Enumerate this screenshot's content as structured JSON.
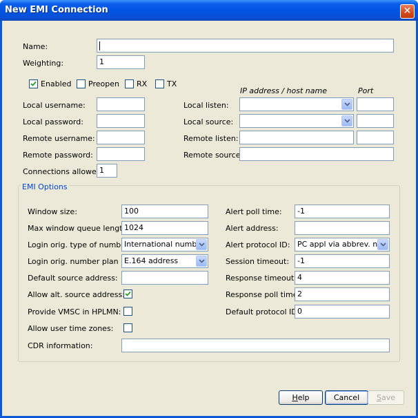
{
  "window": {
    "title": "New EMI Connection",
    "close_glyph": "✕"
  },
  "fields": {
    "name": {
      "label": "Name:",
      "value": ""
    },
    "weighting": {
      "label": "Weighting:",
      "value": "1"
    },
    "enabled": {
      "label": "Enabled",
      "checked": true
    },
    "preopen": {
      "label": "Preopen",
      "checked": false
    },
    "rx": {
      "label": "RX",
      "checked": false
    },
    "tx": {
      "label": "TX",
      "checked": false
    },
    "ip_header": "IP address / host name",
    "port_header": "Port",
    "local_username": {
      "label": "Local username:",
      "value": ""
    },
    "local_password": {
      "label": "Local password:",
      "value": ""
    },
    "remote_username": {
      "label": "Remote username:",
      "value": ""
    },
    "remote_password": {
      "label": "Remote password:",
      "value": ""
    },
    "connections_allowed": {
      "label": "Connections allowed:",
      "value": "1"
    },
    "local_listen": {
      "label": "Local listen:",
      "value": "",
      "port": ""
    },
    "local_source": {
      "label": "Local source:",
      "value": "",
      "port": ""
    },
    "remote_listen": {
      "label": "Remote listen:",
      "value": "",
      "port": ""
    },
    "remote_source": {
      "label": "Remote source:",
      "value": ""
    }
  },
  "emi_options": {
    "title": "EMI Options",
    "window_size": {
      "label": "Window size:",
      "value": "100"
    },
    "max_window_queue": {
      "label": "Max window queue length:",
      "value": "1024"
    },
    "login_type": {
      "label": "Login orig. type of number:",
      "value": "International number"
    },
    "login_plan": {
      "label": "Login orig. number plan ID:",
      "value": "E.164 address"
    },
    "default_source": {
      "label": "Default source address:",
      "value": ""
    },
    "allow_alt_source": {
      "label": "Allow alt. source address:",
      "checked": true
    },
    "provide_vmsc": {
      "label": "Provide VMSC in HPLMN:",
      "checked": false
    },
    "allow_user_tz": {
      "label": "Allow user time zones:",
      "checked": false
    },
    "cdr_info": {
      "label": "CDR information:",
      "value": ""
    },
    "alert_poll_time": {
      "label": "Alert poll time:",
      "value": "-1"
    },
    "alert_address": {
      "label": "Alert address:",
      "value": ""
    },
    "alert_protocol": {
      "label": "Alert protocol ID:",
      "value": "PC appl via abbrev. no."
    },
    "session_timeout": {
      "label": "Session timeout:",
      "value": "-1"
    },
    "response_timeout": {
      "label": "Response timeout:",
      "value": "4"
    },
    "response_poll_time": {
      "label": "Response poll time:",
      "value": "2"
    },
    "default_protocol": {
      "label": "Default protocol ID:",
      "value": "0"
    }
  },
  "buttons": {
    "help": {
      "mnemonic": "H",
      "rest": "elp"
    },
    "cancel": "Cancel",
    "save": {
      "mnemonic": "S",
      "rest": "ave"
    }
  }
}
